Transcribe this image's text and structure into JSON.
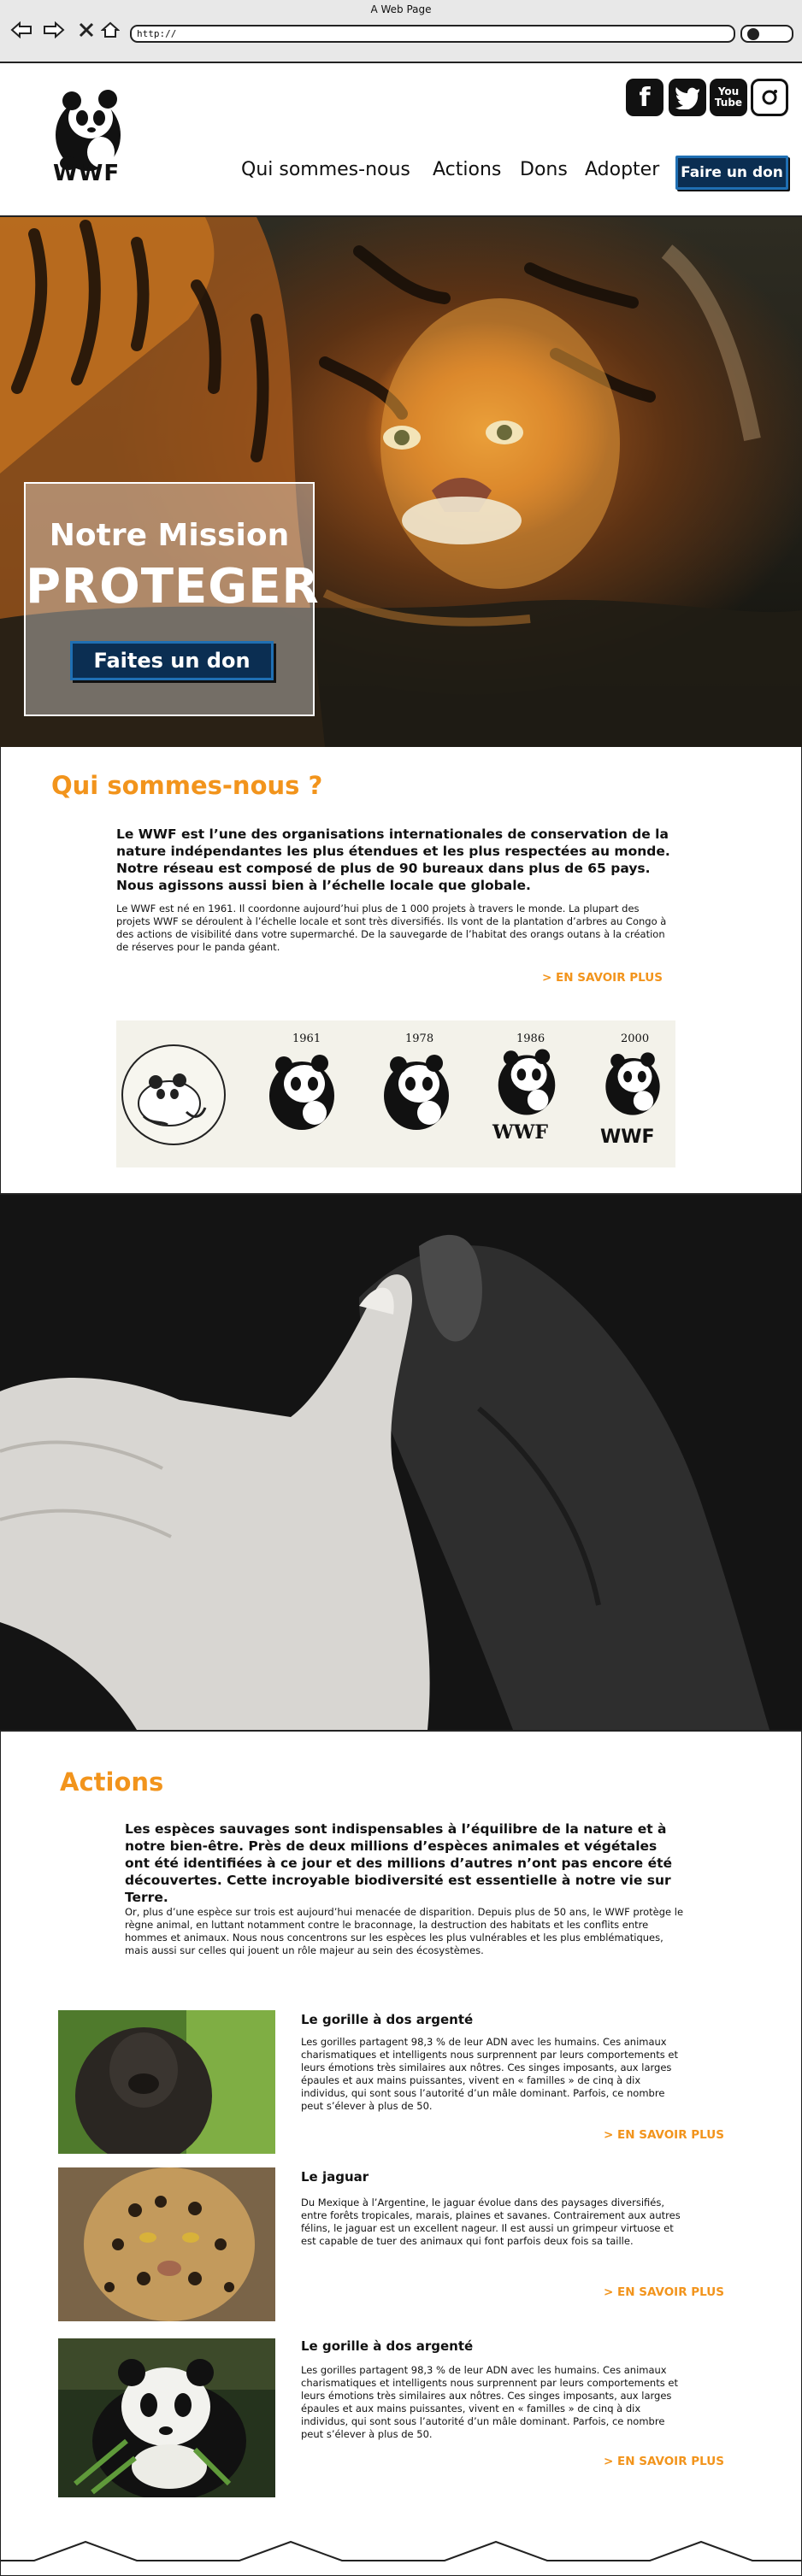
{
  "browser": {
    "title": "A Web Page",
    "url": "http://",
    "back_icon": "arrow-left-icon",
    "forward_icon": "arrow-right-icon",
    "stop_icon": "close-icon",
    "home_icon": "home-icon",
    "search_icon": "search-icon"
  },
  "header": {
    "logo_text": "WWF",
    "social": [
      "facebook-icon",
      "twitter-icon",
      "youtube-icon",
      "instagram-icon"
    ],
    "youtube_label": "You Tube",
    "menu": [
      "Qui sommes-nous",
      "Actions",
      "Dons",
      "Adopter"
    ],
    "cta": "Faire un don",
    "colors": {
      "cta_bg": "#0b2e52",
      "cta_border": "#1f6fb3",
      "accent": "#f2941c"
    }
  },
  "hero": {
    "title": "Notre Mission",
    "word": "PROTEGER",
    "button": "Faites un don"
  },
  "about": {
    "title": "Qui sommes-nous ?",
    "lead": "Le WWF est l’une des organisations internationales de conservation de la nature indépendantes les plus étendues et les plus respectées au monde. Notre réseau est composé de plus de 90 bureaux dans plus de 65 pays. Nous agissons aussi bien à l’échelle locale que globale.",
    "body": "Le WWF est né en 1961. Il coordonne aujourd’hui plus de 1 000 projets à travers le monde. La plupart des projets WWF se déroulent à l’échelle locale et sont très diversifiés. Ils vont de la plantation d’arbres au Congo à des actions de visibilité dans votre supermarché. De la sauvegarde de l’habitat des orangs outans à la création de réserves pour le panda géant.",
    "more": "> EN SAVOIR PLUS",
    "years": [
      "1961",
      "1978",
      "1986",
      "2000"
    ],
    "logo_labels": [
      "WWF",
      "WWF"
    ]
  },
  "actions": {
    "title": "Actions",
    "lead": "Les espèces sauvages sont indispensables à l’équilibre de la nature et à notre bien-être. Près de deux millions d’espèces animales et végétales ont été identifiées à ce jour et des millions d’autres n’ont pas encore été découvertes. Cette incroyable biodiversité est essentielle à notre vie sur Terre.",
    "body": "Or, plus d’une espèce sur trois est aujourd’hui menacée de disparition. Depuis plus de 50 ans, le WWF protège le règne animal, en luttant notamment contre le braconnage, la destruction des habitats et les conflits entre hommes et animaux. Nous nous concentrons sur les espèces les plus vulnérables et les plus emblématiques, mais aussi sur celles qui jouent un rôle majeur au sein des écosystèmes.",
    "cards": [
      {
        "title": "Le gorille à dos argenté",
        "text": "Les gorilles partagent 98,3 % de leur ADN avec les humains. Ces animaux charismatiques et intelligents nous surprennent par leurs comportements et leurs émotions très similaires aux nôtres. Ces singes imposants, aux larges épaules et aux mains puissantes, vivent en « familles » de cinq à dix individus, qui sont sous l’autorité d’un mâle dominant. Parfois, ce nombre peut s’élever à plus de 50.",
        "more": "> EN SAVOIR PLUS"
      },
      {
        "title": "Le jaguar",
        "text": "Du Mexique à l’Argentine, le jaguar évolue dans des paysages diversifiés, entre forêts tropicales, marais, plaines et savanes. Contrairement aux autres félins, le jaguar est un excellent nageur. Il est aussi un grimpeur virtuose et est capable de tuer des animaux qui font parfois deux fois sa taille.",
        "more": "> EN SAVOIR PLUS"
      },
      {
        "title": "Le gorille à dos argenté",
        "text": "Les gorilles partagent 98,3 % de leur ADN avec les humains. Ces animaux charismatiques et intelligents nous surprennent par leurs comportements et leurs émotions très similaires aux nôtres. Ces singes imposants, aux larges épaules et aux mains puissantes, vivent en « familles » de cinq à dix individus, qui sont sous l’autorité d’un mâle dominant. Parfois, ce nombre peut s’élever à plus de 50.",
        "more": "> EN SAVOIR PLUS"
      }
    ]
  }
}
